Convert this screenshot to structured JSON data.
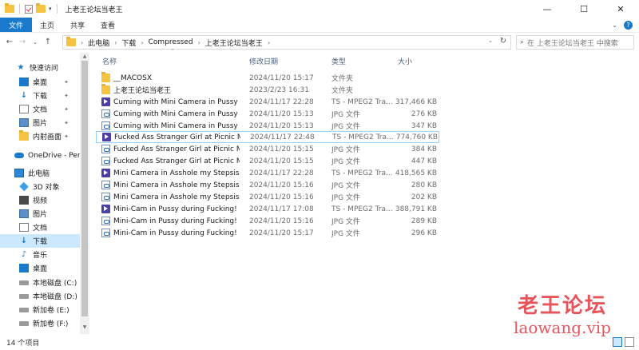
{
  "window": {
    "title": "上老王论坛当老王",
    "controls": {
      "minimize": "—",
      "maximize": "☐",
      "close": "✕"
    }
  },
  "ribbon": {
    "tabs": [
      "文件",
      "主页",
      "共享",
      "查看"
    ],
    "expand_icon": "chevron-down-icon",
    "help_icon_glyph": "?"
  },
  "address": {
    "crumbs": [
      "此电脑",
      "下载",
      "Compressed",
      "上老王论坛当老王"
    ],
    "search_placeholder": "在 上老王论坛当老王 中搜索"
  },
  "sidebar": {
    "items": [
      {
        "label": "快速访问",
        "icon": "star-icon",
        "pinned": false
      },
      {
        "label": "桌面",
        "icon": "desktop-icon",
        "pinned": true
      },
      {
        "label": "下载",
        "icon": "download-icon",
        "pinned": true
      },
      {
        "label": "文档",
        "icon": "document-icon",
        "pinned": true
      },
      {
        "label": "图片",
        "icon": "pictures-icon",
        "pinned": true
      },
      {
        "label": "内射画面",
        "icon": "folder-icon",
        "pinned": true
      },
      {
        "label": "OneDrive - Perso",
        "icon": "onedrive-icon",
        "pinned": false
      },
      {
        "label": "此电脑",
        "icon": "pc-icon",
        "pinned": false
      },
      {
        "label": "3D 对象",
        "icon": "3d-objects-icon",
        "pinned": false
      },
      {
        "label": "视频",
        "icon": "video-icon",
        "pinned": false
      },
      {
        "label": "图片",
        "icon": "pictures-icon",
        "pinned": false
      },
      {
        "label": "文档",
        "icon": "document-icon",
        "pinned": false
      },
      {
        "label": "下载",
        "icon": "download-icon",
        "pinned": false,
        "selected": true
      },
      {
        "label": "音乐",
        "icon": "music-icon",
        "pinned": false
      },
      {
        "label": "桌面",
        "icon": "desktop-icon",
        "pinned": false
      },
      {
        "label": "本地磁盘 (C:)",
        "icon": "drive-icon",
        "pinned": false
      },
      {
        "label": "本地磁盘 (D:)",
        "icon": "drive-icon",
        "pinned": false
      },
      {
        "label": "新加卷 (E:)",
        "icon": "drive-icon",
        "pinned": false
      },
      {
        "label": "新加卷 (F:)",
        "icon": "drive-icon",
        "pinned": false
      }
    ]
  },
  "columns": {
    "name": "名称",
    "modified": "修改日期",
    "type": "类型",
    "size": "大小"
  },
  "files": [
    {
      "name": "__MACOSX",
      "modified": "2024/11/20 15:17",
      "type": "文件夹",
      "size": "",
      "kind": "folder"
    },
    {
      "name": "上老王论坛当老王",
      "modified": "2023/2/23 16:31",
      "type": "文件夹",
      "size": "",
      "kind": "folder"
    },
    {
      "name": "Cuming with Mini Camera in Pussy M...",
      "modified": "2024/11/17 22:28",
      "type": "TS - MPEG2 Tra...",
      "size": "317,466 KB",
      "kind": "ts"
    },
    {
      "name": "Cuming with Mini Camera in Pussy M...",
      "modified": "2024/11/20 15:13",
      "type": "JPG 文件",
      "size": "276 KB",
      "kind": "jpg"
    },
    {
      "name": "Cuming with Mini Camera in Pussy M...",
      "modified": "2024/11/20 15:13",
      "type": "JPG 文件",
      "size": "347 KB",
      "kind": "jpg"
    },
    {
      "name": "Fucked Ass Stranger Girl at Picnic Mi...",
      "modified": "2024/11/17 22:48",
      "type": "TS - MPEG2 Tra...",
      "size": "774,760 KB",
      "kind": "ts",
      "selected": true
    },
    {
      "name": "Fucked Ass Stranger Girl at Picnic Mi...",
      "modified": "2024/11/20 15:15",
      "type": "JPG 文件",
      "size": "384 KB",
      "kind": "jpg"
    },
    {
      "name": "Fucked Ass Stranger Girl at Picnic Mi...",
      "modified": "2024/11/20 15:15",
      "type": "JPG 文件",
      "size": "447 KB",
      "kind": "jpg"
    },
    {
      "name": "Mini Camera in Asshole my Stepsis H...",
      "modified": "2024/11/17 22:28",
      "type": "TS - MPEG2 Tra...",
      "size": "418,565 KB",
      "kind": "ts"
    },
    {
      "name": "Mini Camera in Asshole my Stepsis H...",
      "modified": "2024/11/20 15:16",
      "type": "JPG 文件",
      "size": "280 KB",
      "kind": "jpg"
    },
    {
      "name": "Mini Camera in Asshole my Stepsis H...",
      "modified": "2024/11/20 15:16",
      "type": "JPG 文件",
      "size": "202 KB",
      "kind": "jpg"
    },
    {
      "name": "Mini-Cam in Pussy during Fucking! Gi...",
      "modified": "2024/11/17 17:08",
      "type": "TS - MPEG2 Tra...",
      "size": "388,791 KB",
      "kind": "ts"
    },
    {
      "name": "Mini-Cam in Pussy during Fucking! Gi...",
      "modified": "2024/11/20 15:16",
      "type": "JPG 文件",
      "size": "289 KB",
      "kind": "jpg"
    },
    {
      "name": "Mini-Cam in Pussy during Fucking! Gi...",
      "modified": "2024/11/20 15:17",
      "type": "JPG 文件",
      "size": "296 KB",
      "kind": "jpg"
    }
  ],
  "status": {
    "count": "14 个项目"
  },
  "watermark": {
    "cn": "老王论坛",
    "en": "laowang.vip"
  },
  "colors": {
    "accent": "#1979ca",
    "selection": "#cce8ff",
    "watermark": "#e7545b"
  }
}
